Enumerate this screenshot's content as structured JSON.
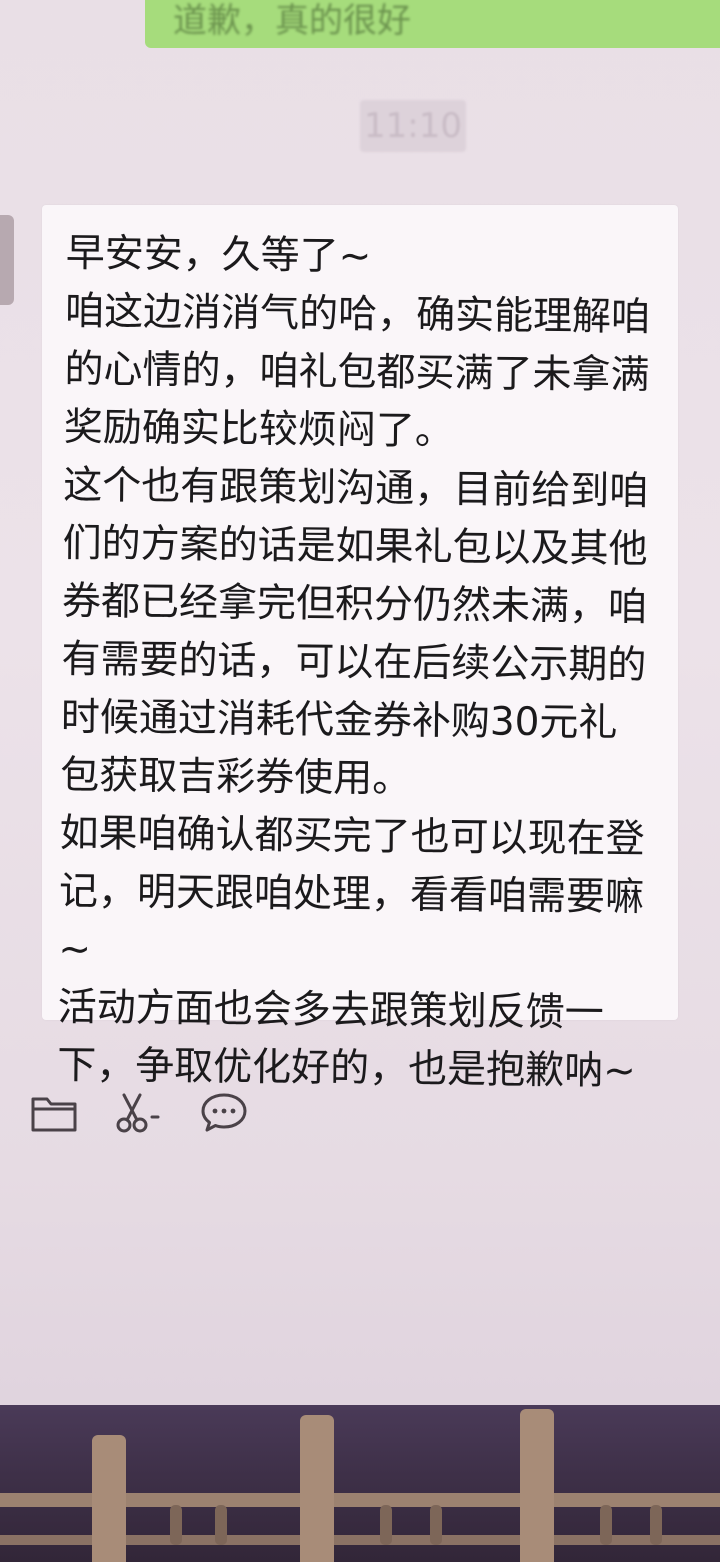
{
  "sent_message": {
    "text": "道歉，真的很好"
  },
  "timestamp": "11:10",
  "received_message": {
    "lines": [
      "早安安，久等了~",
      "咱这边消消气的哈，确实能理解咱",
      "的心情的，咱礼包都买满了未拿满",
      "奖励确实比较烦闷了。",
      "这个也有跟策划沟通，目前给到咱",
      "们的方案的话是如果礼包以及其他",
      "券都已经拿完但积分仍然未满，咱",
      "有需要的话，可以在后续公示期的",
      "时候通过消耗代金券补购30元礼",
      "包获取吉彩券使用。",
      "如果咱确认都买完了也可以现在登",
      "记，明天跟咱处理，看看咱需要嘛",
      "~",
      "活动方面也会多去跟策划反馈一",
      "下，争取优化好的，也是抱歉呐~"
    ]
  },
  "toolbar": {
    "icons": [
      "folder-icon",
      "scissors-icon",
      "chat-bubble-icon"
    ]
  },
  "colors": {
    "sent_bubble": "#a6dc7c",
    "received_bubble": "#faf6f9",
    "background": "#ece2e9",
    "text": "#1b1a1c"
  }
}
